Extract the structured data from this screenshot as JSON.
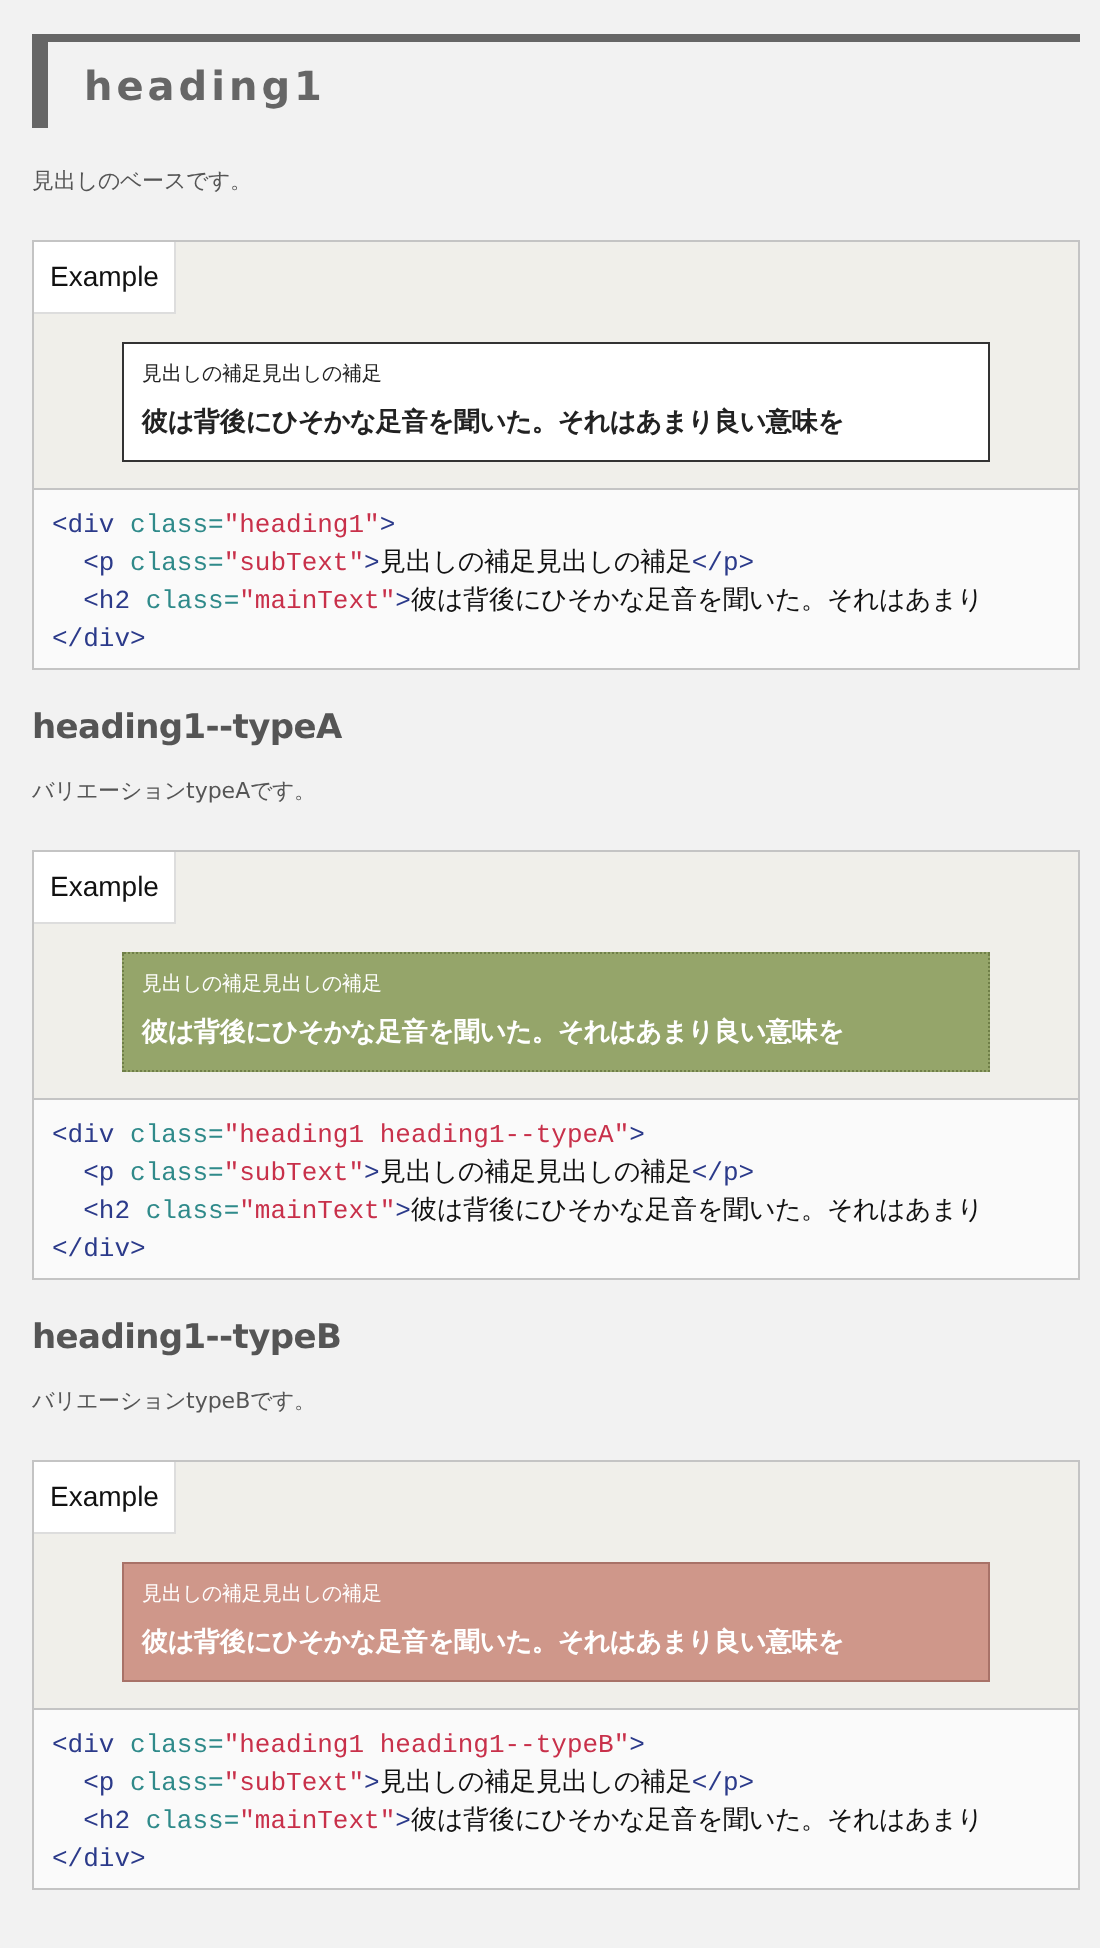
{
  "sections": [
    {
      "kind": "page",
      "title": "heading1",
      "description": "見出しのベースです。",
      "example": {
        "label": "Example",
        "kind": "base",
        "sub_text": "見出しの補足見出しの補足",
        "main_text": "彼は背後にひそかな足音を聞いた。それはあまり良い意味を"
      },
      "code": [
        [
          {
            "kind": "tag",
            "t": "<div"
          },
          {
            "kind": "attr",
            "t": " class="
          },
          {
            "kind": "str",
            "t": "\"heading1\""
          },
          {
            "kind": "tag",
            "t": ">"
          }
        ],
        [
          {
            "kind": "tag",
            "t": "  <p"
          },
          {
            "kind": "attr",
            "t": " class="
          },
          {
            "kind": "str",
            "t": "\"subText\""
          },
          {
            "kind": "tag",
            "t": ">"
          },
          {
            "kind": "text",
            "t": "見出しの補足見出しの補足"
          },
          {
            "kind": "tag",
            "t": "</p>"
          }
        ],
        [
          {
            "kind": "tag",
            "t": "  <h2"
          },
          {
            "kind": "attr",
            "t": " class="
          },
          {
            "kind": "str",
            "t": "\"mainText\""
          },
          {
            "kind": "tag",
            "t": ">"
          },
          {
            "kind": "text",
            "t": "彼は背後にひそかな足音を聞いた。それはあまり"
          }
        ],
        [
          {
            "kind": "tag",
            "t": "</div>"
          }
        ]
      ]
    },
    {
      "kind": "variant",
      "title": "heading1--typeA",
      "description": "バリエーションtypeAです。",
      "example": {
        "label": "Example",
        "kind": "green",
        "sub_text": "見出しの補足見出しの補足",
        "main_text": "彼は背後にひそかな足音を聞いた。それはあまり良い意味を"
      },
      "code": [
        [
          {
            "kind": "tag",
            "t": "<div"
          },
          {
            "kind": "attr",
            "t": " class="
          },
          {
            "kind": "str",
            "t": "\"heading1 heading1--typeA\""
          },
          {
            "kind": "tag",
            "t": ">"
          }
        ],
        [
          {
            "kind": "tag",
            "t": "  <p"
          },
          {
            "kind": "attr",
            "t": " class="
          },
          {
            "kind": "str",
            "t": "\"subText\""
          },
          {
            "kind": "tag",
            "t": ">"
          },
          {
            "kind": "text",
            "t": "見出しの補足見出しの補足"
          },
          {
            "kind": "tag",
            "t": "</p>"
          }
        ],
        [
          {
            "kind": "tag",
            "t": "  <h2"
          },
          {
            "kind": "attr",
            "t": " class="
          },
          {
            "kind": "str",
            "t": "\"mainText\""
          },
          {
            "kind": "tag",
            "t": ">"
          },
          {
            "kind": "text",
            "t": "彼は背後にひそかな足音を聞いた。それはあまり"
          }
        ],
        [
          {
            "kind": "tag",
            "t": "</div>"
          }
        ]
      ]
    },
    {
      "kind": "variant",
      "title": "heading1--typeB",
      "description": "バリエーションtypeBです。",
      "example": {
        "label": "Example",
        "kind": "rose",
        "sub_text": "見出しの補足見出しの補足",
        "main_text": "彼は背後にひそかな足音を聞いた。それはあまり良い意味を"
      },
      "code": [
        [
          {
            "kind": "tag",
            "t": "<div"
          },
          {
            "kind": "attr",
            "t": " class="
          },
          {
            "kind": "str",
            "t": "\"heading1 heading1--typeB\""
          },
          {
            "kind": "tag",
            "t": ">"
          }
        ],
        [
          {
            "kind": "tag",
            "t": "  <p"
          },
          {
            "kind": "attr",
            "t": " class="
          },
          {
            "kind": "str",
            "t": "\"subText\""
          },
          {
            "kind": "tag",
            "t": ">"
          },
          {
            "kind": "text",
            "t": "見出しの補足見出しの補足"
          },
          {
            "kind": "tag",
            "t": "</p>"
          }
        ],
        [
          {
            "kind": "tag",
            "t": "  <h2"
          },
          {
            "kind": "attr",
            "t": " class="
          },
          {
            "kind": "str",
            "t": "\"mainText\""
          },
          {
            "kind": "tag",
            "t": ">"
          },
          {
            "kind": "text",
            "t": "彼は背後にひそかな足音を聞いた。それはあまり"
          }
        ],
        [
          {
            "kind": "tag",
            "t": "</div>"
          }
        ]
      ]
    }
  ]
}
